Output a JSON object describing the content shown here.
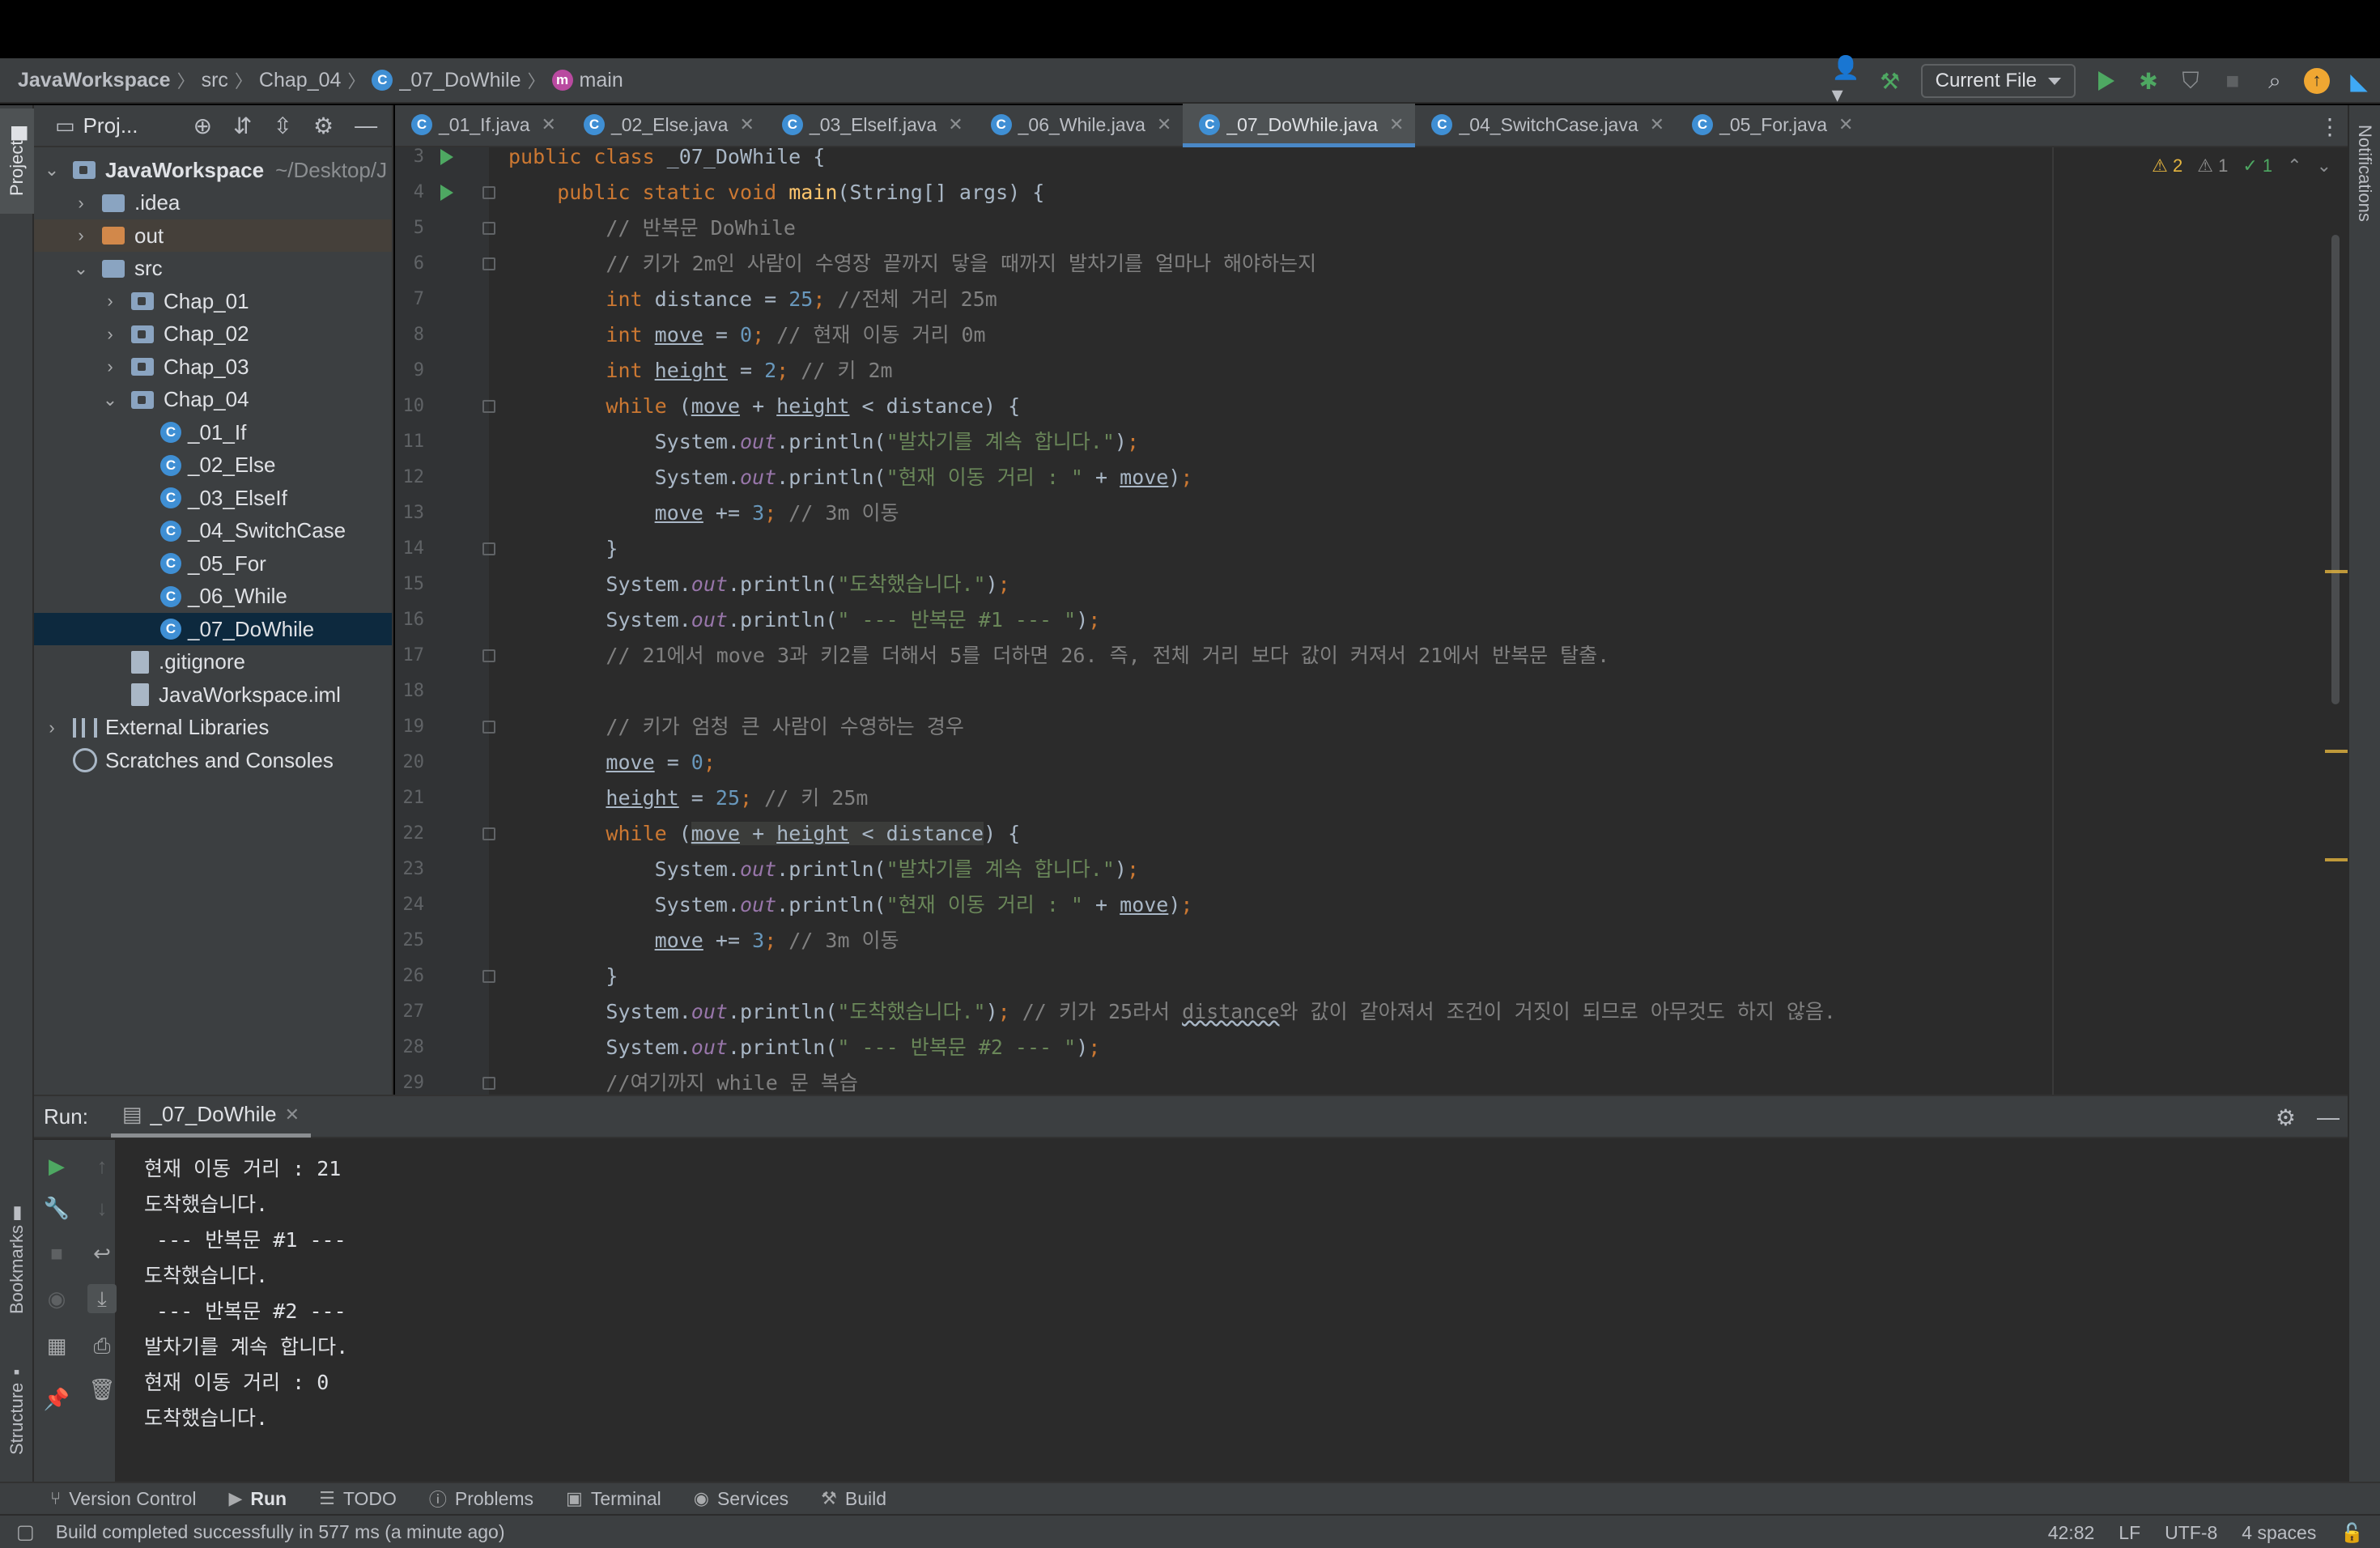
{
  "breadcrumb": {
    "items": [
      "JavaWorkspace",
      "src",
      "Chap_04",
      "_07_DoWhile",
      "main"
    ]
  },
  "toolbar": {
    "run_config": "Current File"
  },
  "project_panel": {
    "title": "Proj...",
    "tree": [
      {
        "label": "JavaWorkspace",
        "extra": "~/Desktop/J",
        "level": 0,
        "type": "module",
        "expanded": true
      },
      {
        "label": ".idea",
        "level": 1,
        "type": "folder",
        "expanded": false
      },
      {
        "label": "out",
        "level": 1,
        "type": "folder-excluded",
        "expanded": false
      },
      {
        "label": "src",
        "level": 1,
        "type": "folder",
        "expanded": true
      },
      {
        "label": "Chap_01",
        "level": 2,
        "type": "package",
        "expanded": false
      },
      {
        "label": "Chap_02",
        "level": 2,
        "type": "package",
        "expanded": false
      },
      {
        "label": "Chap_03",
        "level": 2,
        "type": "package",
        "expanded": false
      },
      {
        "label": "Chap_04",
        "level": 2,
        "type": "package",
        "expanded": true
      },
      {
        "label": "_01_If",
        "level": 3,
        "type": "class"
      },
      {
        "label": "_02_Else",
        "level": 3,
        "type": "class"
      },
      {
        "label": "_03_ElseIf",
        "level": 3,
        "type": "class"
      },
      {
        "label": "_04_SwitchCase",
        "level": 3,
        "type": "class"
      },
      {
        "label": "_05_For",
        "level": 3,
        "type": "class"
      },
      {
        "label": "_06_While",
        "level": 3,
        "type": "class"
      },
      {
        "label": "_07_DoWhile",
        "level": 3,
        "type": "class",
        "selected": true
      },
      {
        "label": ".gitignore",
        "level": 2,
        "type": "file"
      },
      {
        "label": "JavaWorkspace.iml",
        "level": 2,
        "type": "file"
      },
      {
        "label": "External Libraries",
        "level": 0,
        "type": "library",
        "expanded": false
      },
      {
        "label": "Scratches and Consoles",
        "level": 0,
        "type": "scratch"
      }
    ]
  },
  "tabs": [
    {
      "label": "_01_If.java",
      "active": false
    },
    {
      "label": "_02_Else.java",
      "active": false
    },
    {
      "label": "_03_ElseIf.java",
      "active": false
    },
    {
      "label": "_06_While.java",
      "active": false
    },
    {
      "label": "_07_DoWhile.java",
      "active": true
    },
    {
      "label": "_04_SwitchCase.java",
      "active": false
    },
    {
      "label": "_05_For.java",
      "active": false
    }
  ],
  "inspections": {
    "warnings": "2",
    "weak_warnings": "1",
    "typos": "1"
  },
  "code_lines": [
    {
      "n": "3",
      "run": true,
      "tokens": [
        [
          "kw",
          "public class "
        ],
        [
          "",
          "_07_DoWhile {"
        ]
      ]
    },
    {
      "n": "4",
      "run": true,
      "fold": true,
      "tokens": [
        [
          "",
          "    "
        ],
        [
          "kw",
          "public static void "
        ],
        [
          "fn",
          "main"
        ],
        [
          "",
          "(String[] args) {"
        ]
      ]
    },
    {
      "n": "5",
      "fold": true,
      "tokens": [
        [
          "cmt",
          "        // 반복문 DoWhile"
        ]
      ]
    },
    {
      "n": "6",
      "fold": true,
      "tokens": [
        [
          "cmt",
          "        // 키가 2m인 사람이 수영장 끝까지 닿을 때까지 발차기를 얼마나 해야하는지"
        ]
      ]
    },
    {
      "n": "7",
      "tokens": [
        [
          "",
          "        "
        ],
        [
          "kw",
          "int "
        ],
        [
          "",
          "distance = "
        ],
        [
          "num",
          "25"
        ],
        [
          "kw",
          "; "
        ],
        [
          "cmt",
          "//전체 거리 25m"
        ]
      ]
    },
    {
      "n": "8",
      "tokens": [
        [
          "",
          "        "
        ],
        [
          "kw",
          "int "
        ],
        [
          "ul",
          "move"
        ],
        [
          "",
          " = "
        ],
        [
          "num",
          "0"
        ],
        [
          "kw",
          "; "
        ],
        [
          "cmt",
          "// 현재 이동 거리 0m"
        ]
      ]
    },
    {
      "n": "9",
      "tokens": [
        [
          "",
          "        "
        ],
        [
          "kw",
          "int "
        ],
        [
          "ul",
          "height"
        ],
        [
          "",
          " = "
        ],
        [
          "num",
          "2"
        ],
        [
          "kw",
          "; "
        ],
        [
          "cmt",
          "// 키 2m"
        ]
      ]
    },
    {
      "n": "10",
      "fold": true,
      "tokens": [
        [
          "",
          "        "
        ],
        [
          "kw",
          "while "
        ],
        [
          "",
          "("
        ],
        [
          "ul",
          "move"
        ],
        [
          "",
          " + "
        ],
        [
          "ul",
          "height"
        ],
        [
          "",
          " < distance) {"
        ]
      ]
    },
    {
      "n": "11",
      "tokens": [
        [
          "",
          "            System."
        ],
        [
          "fld",
          "out"
        ],
        [
          "",
          ".println("
        ],
        [
          "str",
          "\"발차기를 계속 합니다.\""
        ],
        [
          "",
          ")"
        ],
        [
          "kw",
          ";"
        ]
      ]
    },
    {
      "n": "12",
      "tokens": [
        [
          "",
          "            System."
        ],
        [
          "fld",
          "out"
        ],
        [
          "",
          ".println("
        ],
        [
          "str",
          "\"현재 이동 거리 : \""
        ],
        [
          "",
          " + "
        ],
        [
          "ul",
          "move"
        ],
        [
          "",
          ")"
        ],
        [
          "kw",
          ";"
        ]
      ]
    },
    {
      "n": "13",
      "tokens": [
        [
          "",
          "            "
        ],
        [
          "ul",
          "move"
        ],
        [
          "",
          " += "
        ],
        [
          "num",
          "3"
        ],
        [
          "kw",
          "; "
        ],
        [
          "cmt",
          "// 3m 이동"
        ]
      ]
    },
    {
      "n": "14",
      "fold": true,
      "tokens": [
        [
          "",
          "        }"
        ]
      ]
    },
    {
      "n": "15",
      "tokens": [
        [
          "",
          "        System."
        ],
        [
          "fld",
          "out"
        ],
        [
          "",
          ".println("
        ],
        [
          "str",
          "\"도착했습니다.\""
        ],
        [
          "",
          ")"
        ],
        [
          "kw",
          ";"
        ]
      ]
    },
    {
      "n": "16",
      "tokens": [
        [
          "",
          "        System."
        ],
        [
          "fld",
          "out"
        ],
        [
          "",
          ".println("
        ],
        [
          "str",
          "\" --- 반복문 #1 --- \""
        ],
        [
          "",
          ")"
        ],
        [
          "kw",
          ";"
        ]
      ]
    },
    {
      "n": "17",
      "fold": true,
      "tokens": [
        [
          "cmt",
          "        // 21에서 move 3과 키2를 더해서 5를 더하면 26. 즉, 전체 거리 보다 값이 커져서 21에서 반복문 탈출."
        ]
      ]
    },
    {
      "n": "18",
      "tokens": [
        [
          "",
          ""
        ]
      ]
    },
    {
      "n": "19",
      "fold": true,
      "tokens": [
        [
          "cmt",
          "        // 키가 엄청 큰 사람이 수영하는 경우"
        ]
      ]
    },
    {
      "n": "20",
      "tokens": [
        [
          "",
          "        "
        ],
        [
          "ul",
          "move"
        ],
        [
          "",
          " = "
        ],
        [
          "num",
          "0"
        ],
        [
          "kw",
          ";"
        ]
      ]
    },
    {
      "n": "21",
      "tokens": [
        [
          "",
          "        "
        ],
        [
          "ul",
          "height"
        ],
        [
          "",
          " = "
        ],
        [
          "num",
          "25"
        ],
        [
          "kw",
          "; "
        ],
        [
          "cmt",
          "// 키 25m"
        ]
      ]
    },
    {
      "n": "22",
      "fold": true,
      "tokens": [
        [
          "",
          "        "
        ],
        [
          "kw",
          "while "
        ],
        [
          "",
          "("
        ],
        [
          "ul hl",
          "move"
        ],
        [
          "hl",
          " + "
        ],
        [
          "ul hl",
          "height"
        ],
        [
          "hl",
          " < distance"
        ],
        [
          "",
          ") {"
        ]
      ]
    },
    {
      "n": "23",
      "tokens": [
        [
          "",
          "            System."
        ],
        [
          "fld",
          "out"
        ],
        [
          "",
          ".println("
        ],
        [
          "str",
          "\"발차기를 계속 합니다.\""
        ],
        [
          "",
          ")"
        ],
        [
          "kw",
          ";"
        ]
      ]
    },
    {
      "n": "24",
      "tokens": [
        [
          "",
          "            System."
        ],
        [
          "fld",
          "out"
        ],
        [
          "",
          ".println("
        ],
        [
          "str",
          "\"현재 이동 거리 : \""
        ],
        [
          "",
          " + "
        ],
        [
          "ul",
          "move"
        ],
        [
          "",
          ")"
        ],
        [
          "kw",
          ";"
        ]
      ]
    },
    {
      "n": "25",
      "tokens": [
        [
          "",
          "            "
        ],
        [
          "ul",
          "move"
        ],
        [
          "",
          " += "
        ],
        [
          "num",
          "3"
        ],
        [
          "kw",
          "; "
        ],
        [
          "cmt",
          "// 3m 이동"
        ]
      ]
    },
    {
      "n": "26",
      "fold": true,
      "tokens": [
        [
          "",
          "        }"
        ]
      ]
    },
    {
      "n": "27",
      "tokens": [
        [
          "",
          "        System."
        ],
        [
          "fld",
          "out"
        ],
        [
          "",
          ".println("
        ],
        [
          "str",
          "\"도착했습니다.\""
        ],
        [
          "",
          ")"
        ],
        [
          "kw",
          "; "
        ],
        [
          "cmt",
          "// 키가 25라서 "
        ],
        [
          "cmt squig",
          "distance"
        ],
        [
          "cmt",
          "와 값이 같아져서 조건이 거짓이 되므로 아무것도 하지 않음."
        ]
      ]
    },
    {
      "n": "28",
      "tokens": [
        [
          "",
          "        System."
        ],
        [
          "fld",
          "out"
        ],
        [
          "",
          ".println("
        ],
        [
          "str",
          "\" --- 반복문 #2 --- \""
        ],
        [
          "",
          ")"
        ],
        [
          "kw",
          ";"
        ]
      ]
    },
    {
      "n": "29",
      "fold": true,
      "tokens": [
        [
          "cmt",
          "        //여기까지 while 문 복습"
        ]
      ]
    }
  ],
  "run_panel": {
    "label": "Run:",
    "tab": "_07_DoWhile",
    "output": [
      "현재 이동 거리 : 21",
      "도착했습니다.",
      " --- 반복문 #1 --- ",
      "도착했습니다.",
      " --- 반복문 #2 --- ",
      "발차기를 계속 합니다.",
      "현재 이동 거리 : 0",
      "도착했습니다."
    ]
  },
  "side_tabs": {
    "project": "Project",
    "bookmarks": "Bookmarks",
    "structure": "Structure",
    "notifications": "Notifications"
  },
  "bottom_tools": [
    {
      "label": "Version Control",
      "icon": "branch-icon"
    },
    {
      "label": "Run",
      "icon": "play-icon",
      "active": true
    },
    {
      "label": "TODO",
      "icon": "list-icon"
    },
    {
      "label": "Problems",
      "icon": "info-icon"
    },
    {
      "label": "Terminal",
      "icon": "terminal-icon"
    },
    {
      "label": "Services",
      "icon": "services-icon"
    },
    {
      "label": "Build",
      "icon": "hammer-icon"
    }
  ],
  "status": {
    "message": "Build completed successfully in 577 ms (a minute ago)",
    "position": "42:82",
    "line_sep": "LF",
    "encoding": "UTF-8",
    "indent": "4 spaces"
  }
}
